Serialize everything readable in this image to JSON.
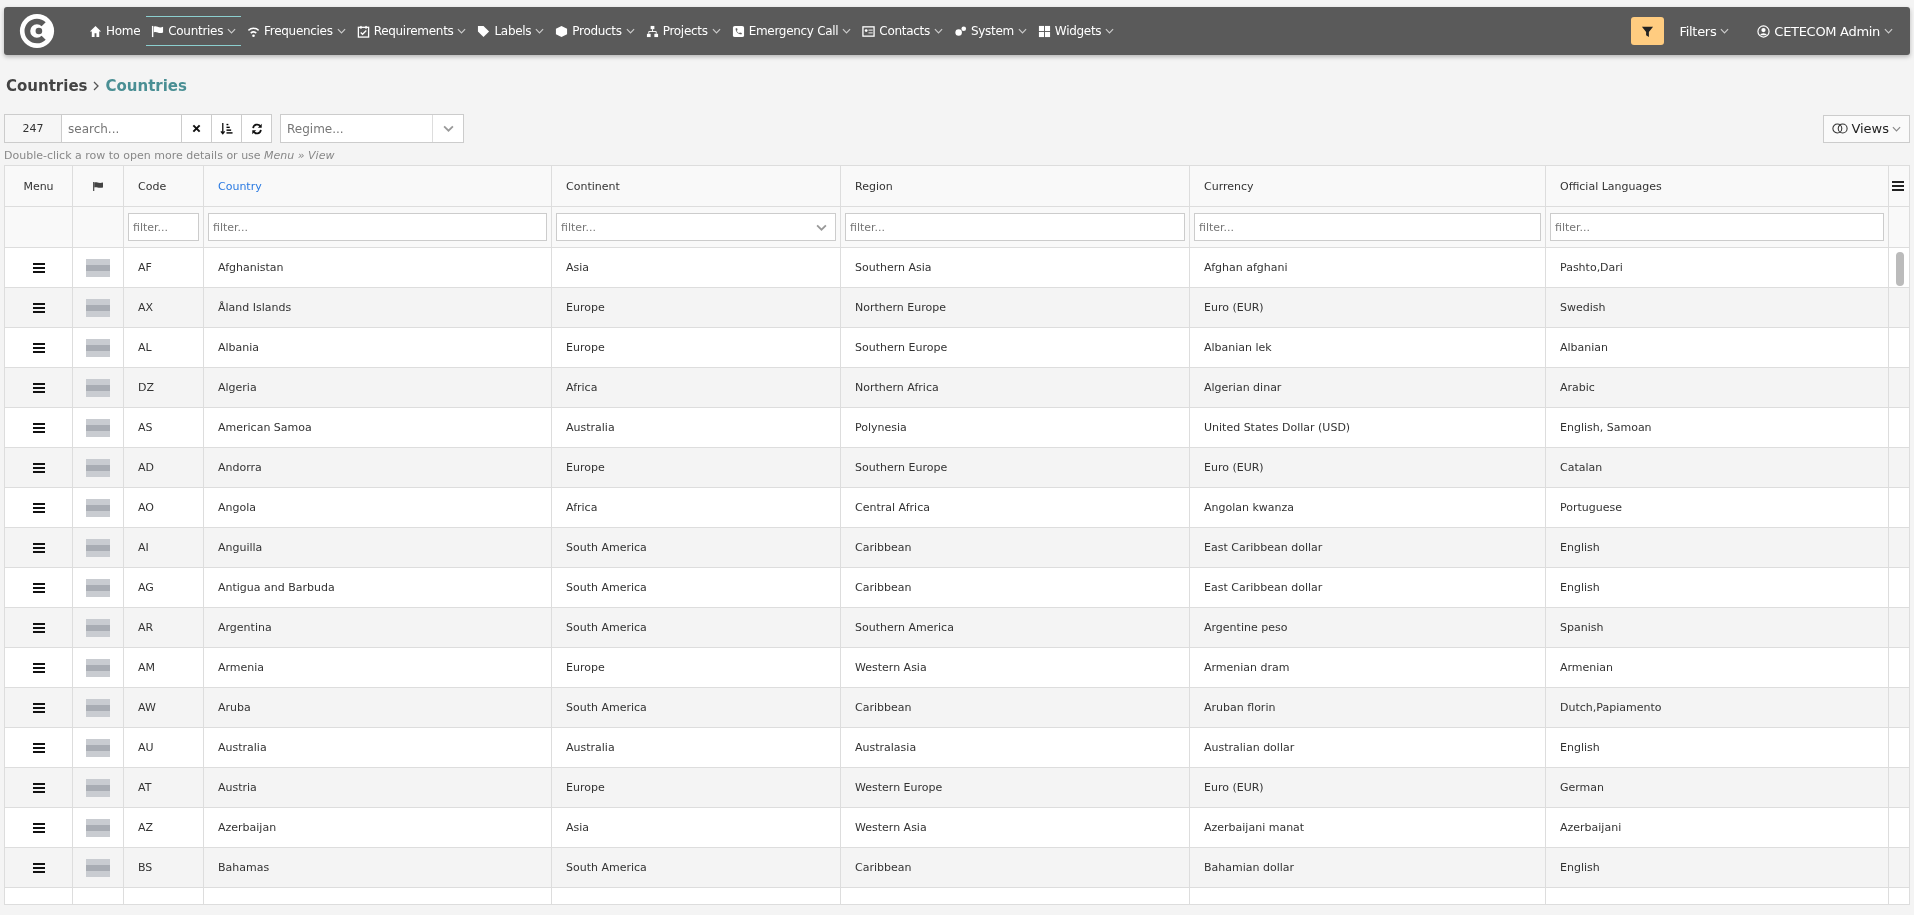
{
  "nav": {
    "items": [
      {
        "label": "Home",
        "selected": false,
        "dropdown": false
      },
      {
        "label": "Countries",
        "selected": true,
        "dropdown": true
      },
      {
        "label": "Frequencies",
        "selected": false,
        "dropdown": true
      },
      {
        "label": "Requirements",
        "selected": false,
        "dropdown": true
      },
      {
        "label": "Labels",
        "selected": false,
        "dropdown": true
      },
      {
        "label": "Products",
        "selected": false,
        "dropdown": true
      },
      {
        "label": "Projects",
        "selected": false,
        "dropdown": true
      },
      {
        "label": "Emergency Call",
        "selected": false,
        "dropdown": true
      },
      {
        "label": "Contacts",
        "selected": false,
        "dropdown": true
      },
      {
        "label": "System",
        "selected": false,
        "dropdown": true
      },
      {
        "label": "Widgets",
        "selected": false,
        "dropdown": true
      }
    ],
    "filters": "Filters",
    "user": "CETECOM Admin"
  },
  "breadcrumb": [
    "Countries",
    "Countries"
  ],
  "toolbar": {
    "count": "247",
    "search_placeholder": "search...",
    "regime_placeholder": "Regime...",
    "views": "Views"
  },
  "hint": "Double-click a row to open more details or use *Menu » View*",
  "table": {
    "columns": [
      {
        "kind": "text",
        "label": "Menu",
        "sorted": false
      },
      {
        "kind": "flag",
        "sorted": false
      },
      {
        "kind": "text",
        "label": "Code",
        "sorted": false
      },
      {
        "kind": "text",
        "label": "Country",
        "sorted": true
      },
      {
        "kind": "text",
        "label": "Continent",
        "sorted": false
      },
      {
        "kind": "text",
        "label": "Region",
        "sorted": false
      },
      {
        "kind": "text",
        "label": "Currency",
        "sorted": false
      },
      {
        "kind": "text",
        "label": "Official Languages",
        "sorted": false
      }
    ],
    "filters": [
      {
        "kind": "none"
      },
      {
        "kind": "none"
      },
      {
        "kind": "text",
        "placeholder": "filter..."
      },
      {
        "kind": "text",
        "placeholder": "filter..."
      },
      {
        "kind": "select",
        "placeholder": "filter..."
      },
      {
        "kind": "text",
        "placeholder": "filter..."
      },
      {
        "kind": "text",
        "placeholder": "filter..."
      },
      {
        "kind": "text",
        "placeholder": "filter..."
      }
    ],
    "rows": [
      {
        "code": "AF",
        "country": "Afghanistan",
        "continent": "Asia",
        "region": "Southern Asia",
        "currency": "Afghan afghani",
        "languages": "Pashto,Dari"
      },
      {
        "code": "AX",
        "country": "Åland Islands",
        "continent": "Europe",
        "region": "Northern Europe",
        "currency": "Euro (EUR)",
        "languages": "Swedish"
      },
      {
        "code": "AL",
        "country": "Albania",
        "continent": "Europe",
        "region": "Southern Europe",
        "currency": "Albanian lek",
        "languages": "Albanian"
      },
      {
        "code": "DZ",
        "country": "Algeria",
        "continent": "Africa",
        "region": "Northern Africa",
        "currency": "Algerian dinar",
        "languages": "Arabic"
      },
      {
        "code": "AS",
        "country": "American Samoa",
        "continent": "Australia",
        "region": "Polynesia",
        "currency": "United States Dollar (USD)",
        "languages": "English, Samoan"
      },
      {
        "code": "AD",
        "country": "Andorra",
        "continent": "Europe",
        "region": "Southern Europe",
        "currency": "Euro (EUR)",
        "languages": "Catalan"
      },
      {
        "code": "AO",
        "country": "Angola",
        "continent": "Africa",
        "region": "Central Africa",
        "currency": "Angolan kwanza",
        "languages": "Portuguese"
      },
      {
        "code": "AI",
        "country": "Anguilla",
        "continent": "South America",
        "region": "Caribbean",
        "currency": "East Caribbean dollar",
        "languages": "English"
      },
      {
        "code": "AG",
        "country": "Antigua and Barbuda",
        "continent": "South America",
        "region": "Caribbean",
        "currency": "East Caribbean dollar",
        "languages": "English"
      },
      {
        "code": "AR",
        "country": "Argentina",
        "continent": "South America",
        "region": "Southern America",
        "currency": "Argentine peso",
        "languages": "Spanish"
      },
      {
        "code": "AM",
        "country": "Armenia",
        "continent": "Europe",
        "region": "Western Asia",
        "currency": "Armenian dram",
        "languages": "Armenian"
      },
      {
        "code": "AW",
        "country": "Aruba",
        "continent": "South America",
        "region": "Caribbean",
        "currency": "Aruban florin",
        "languages": "Dutch,Papiamento"
      },
      {
        "code": "AU",
        "country": "Australia",
        "continent": "Australia",
        "region": "Australasia",
        "currency": "Australian dollar",
        "languages": "English"
      },
      {
        "code": "AT",
        "country": "Austria",
        "continent": "Europe",
        "region": "Western Europe",
        "currency": "Euro (EUR)",
        "languages": "German"
      },
      {
        "code": "AZ",
        "country": "Azerbaijan",
        "continent": "Asia",
        "region": "Western Asia",
        "currency": "Azerbaijani manat",
        "languages": "Azerbaijani"
      },
      {
        "code": "BS",
        "country": "Bahamas",
        "continent": "South America",
        "region": "Caribbean",
        "currency": "Bahamian dollar",
        "languages": "English"
      }
    ]
  }
}
